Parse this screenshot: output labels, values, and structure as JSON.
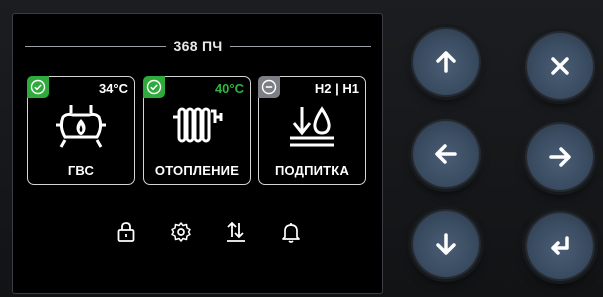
{
  "header": {
    "title": "368 ПЧ"
  },
  "tiles": [
    {
      "label": "ГВС",
      "value": "34°C",
      "status": "ok",
      "status_icon": "check-circle-icon",
      "icon": "boiler-flame-icon",
      "value_color": "#ffffff"
    },
    {
      "label": "ОТОПЛЕНИЕ",
      "value": "40°C",
      "status": "ok",
      "status_icon": "check-circle-icon",
      "icon": "radiator-icon",
      "value_color": "#2fb43f"
    },
    {
      "label": "ПОДПИТКА",
      "value": "H2 | H1",
      "status": "off",
      "status_icon": "minus-circle-icon",
      "icon": "water-level-icon",
      "value_color": "#ffffff"
    }
  ],
  "bottom_icons": [
    "lock-icon",
    "gear-icon",
    "transfer-icon",
    "bell-icon"
  ],
  "hardware_buttons": [
    "up-arrow",
    "close",
    "left-arrow",
    "right-arrow",
    "down-arrow",
    "enter"
  ],
  "colors": {
    "status_ok": "#2faa3c",
    "status_off": "#7b7f85",
    "button": "#3f5268",
    "screen_bg": "#000000"
  }
}
